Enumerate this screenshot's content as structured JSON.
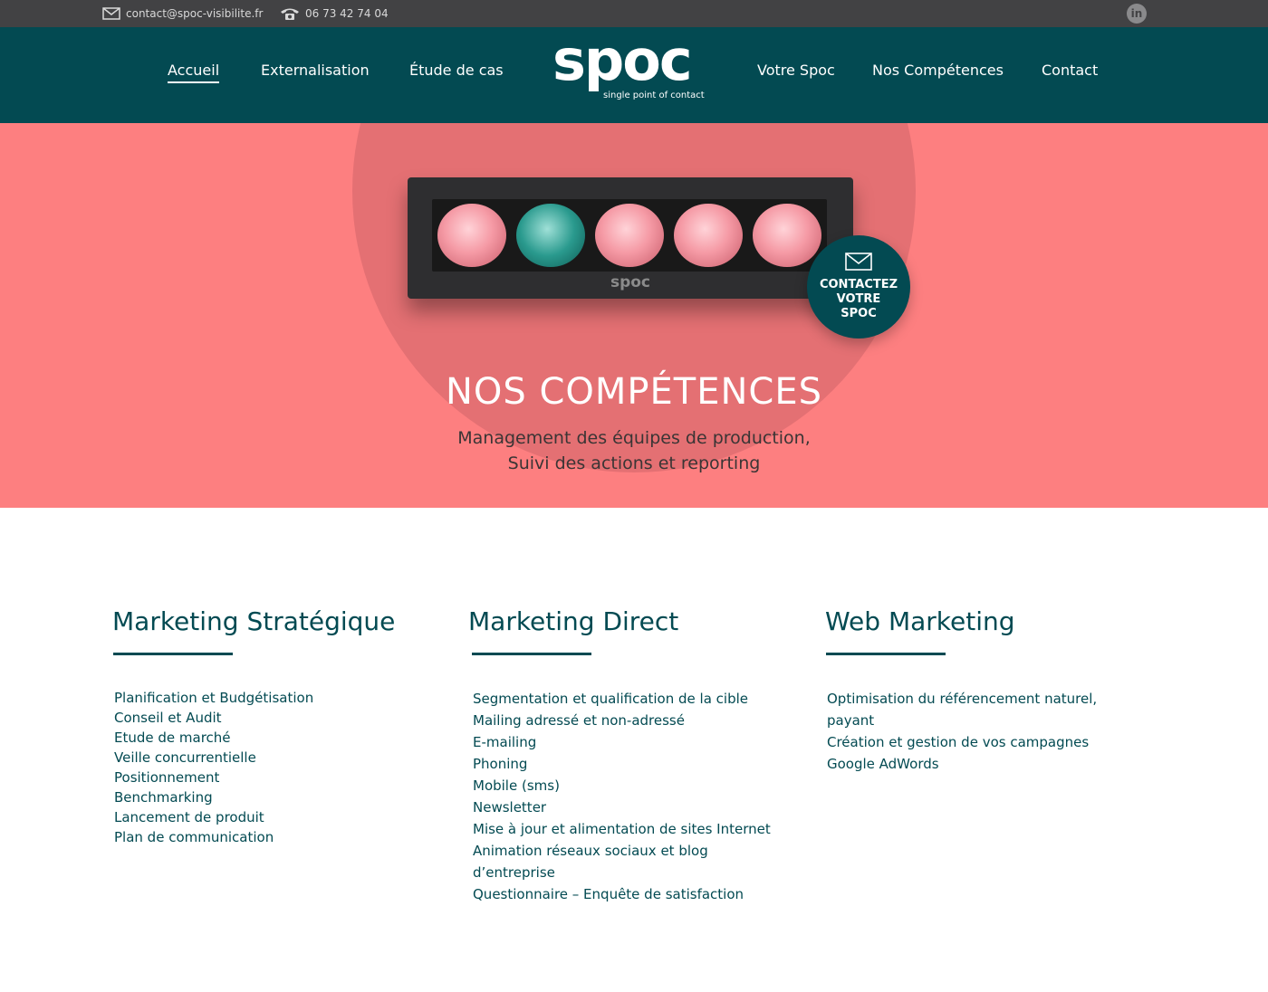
{
  "topbar": {
    "email": "contact@spoc-visibilite.fr",
    "phone": "06 73 42 74 04",
    "linkedin": "in"
  },
  "nav": {
    "left": [
      "Accueil",
      "Externalisation",
      "Étude de cas"
    ],
    "right": [
      "Votre Spoc",
      "Nos Compétences",
      "Contact"
    ]
  },
  "logo": {
    "word": "spoc",
    "tagline": "single point of contact"
  },
  "hero": {
    "box_label": "spoc",
    "cta": [
      "CONTACTEZ",
      "VOTRE",
      "SPOC"
    ],
    "title": "NOS COMPÉTENCES",
    "subtitle": [
      "Management des équipes de production,",
      "Suivi des actions et reporting"
    ]
  },
  "columns": [
    {
      "title": "Marketing Stratégique",
      "items": [
        "Planification et Budgétisation",
        "Conseil et Audit",
        "Etude de marché",
        "Veille concurrentielle",
        "Positionnement",
        "Benchmarking",
        "Lancement de produit",
        "Plan de communication"
      ]
    },
    {
      "title": "Marketing Direct",
      "items": [
        "Segmentation et qualification de la cible",
        "Mailing adressé et non-adressé",
        "E-mailing",
        "Phoning",
        "Mobile (sms)",
        "Newsletter",
        "Mise à jour et alimentation de sites Internet",
        "Animation réseaux sociaux et blog",
        "d’entreprise",
        "Questionnaire – Enquête de satisfaction"
      ]
    },
    {
      "title": "Web Marketing",
      "items": [
        "Optimisation du référencement naturel,",
        "payant",
        "Création et gestion de vos campagnes",
        "Google AdWords"
      ]
    }
  ],
  "colors": {
    "topbar": "#424244",
    "header": "#034a52",
    "hero": "#fd7f80",
    "accent": "#034a52"
  }
}
